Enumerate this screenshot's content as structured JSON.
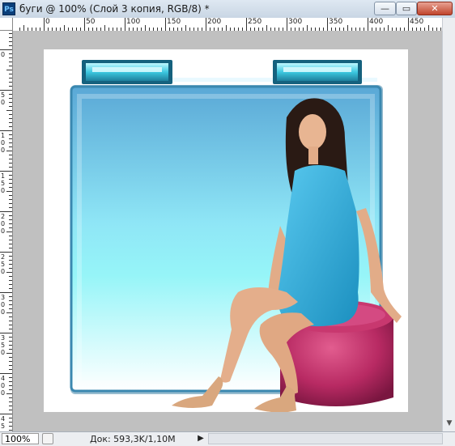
{
  "window": {
    "app_icon": "Ps",
    "title": "буги @ 100% (Слой 3 копия, RGB/8) *",
    "min_glyph": "—",
    "max_glyph": "▭",
    "close_glyph": "✕"
  },
  "ruler": {
    "top_labels": [
      "0",
      "50",
      "100",
      "150",
      "200",
      "250",
      "300",
      "350",
      "400",
      "450"
    ],
    "left_labels": [
      "0",
      "5\n0",
      "1\n0\n0",
      "1\n5\n0",
      "2\n0\n0",
      "2\n5\n0",
      "3\n0\n0",
      "3\n5\n0",
      "4\n0\n0",
      "4\n5"
    ]
  },
  "status": {
    "zoom": "100%",
    "doc_info": "Док: 593,3K/1,10M",
    "play_glyph": "▶"
  },
  "colors": {
    "frame_blue_top": "#5aa9d6",
    "frame_aqua": "#8ff2f8",
    "ottoman_pink": "#c0306a",
    "dress_blue": "#2ea8d8"
  }
}
